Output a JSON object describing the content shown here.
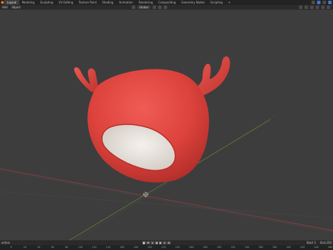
{
  "app": {
    "workspace_tabs": [
      "Layout",
      "Modeling",
      "Sculpting",
      "UV Editing",
      "Texture Paint",
      "Shading",
      "Animation",
      "Rendering",
      "Compositing",
      "Geometry Nodes",
      "Scripting",
      "+"
    ],
    "active_tab_index": 0
  },
  "viewport_header": {
    "menus": [
      "Add",
      "Object"
    ],
    "transform_orientation": "Global"
  },
  "timeline": {
    "label": "ection",
    "start_label": "Start",
    "start_value": "1",
    "end_label": "End",
    "end_value": "250",
    "ruler_ticks": [
      "0",
      "20",
      "40",
      "60",
      "80",
      "100",
      "120",
      "140",
      "160",
      "180",
      "200",
      "220",
      "240",
      "260",
      "280",
      "300",
      "320",
      "340",
      "360",
      "380",
      "400",
      "420",
      "440",
      "460"
    ]
  },
  "colors": {
    "viewport_bg": "#3d3d3d",
    "model_red": "#e0453f",
    "model_inner": "#e9e4de",
    "x_axis": "#b0434a",
    "y_axis": "#7c9a3e"
  }
}
